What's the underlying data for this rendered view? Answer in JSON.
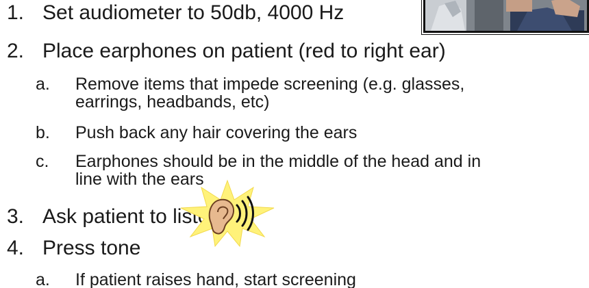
{
  "slide": {
    "items": [
      {
        "number": "1.",
        "text": "Set audiometer to 50db, 4000 Hz"
      },
      {
        "number": "2.",
        "text": "Place earphones on patient (red to right ear)"
      },
      {
        "number": "3.",
        "text": "Ask patient to listen"
      },
      {
        "number": "4.",
        "text": "Press tone"
      }
    ],
    "subitems": {
      "a1_letter": "a.",
      "a1_line1": "Remove items that impede screening (e.g. glasses,",
      "a1_line2": "earrings, headbands, etc)",
      "b_letter": "b.",
      "b_text": "Push back any hair covering the ears",
      "c_letter": "c.",
      "c_line1": "Earphones should be in the middle of the head and in",
      "c_line2": "line with the ears",
      "d_letter": "a.",
      "d_text": "If patient raises hand, start screening"
    }
  },
  "icons": {
    "photo": "screening-photo",
    "ear": "ear-listening-icon",
    "burst": "burst-star-icon"
  },
  "colors": {
    "text": "#1a1a1a",
    "burst": "#fff27a",
    "ear": "#e7b98f"
  }
}
